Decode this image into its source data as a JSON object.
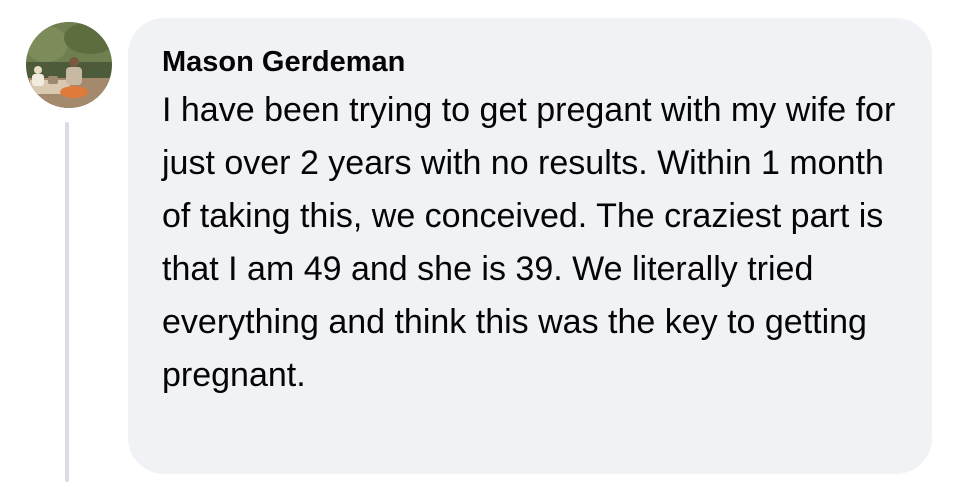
{
  "comment": {
    "author": "Mason Gerdeman",
    "text": "I have been trying to get pregant with my wife for just over 2 years with no results. Within 1 month of taking this, we conceived. The craziest part is that I am 49 and she is 39. We literally tried everything and think this was the key to getting pregnant."
  },
  "colors": {
    "bubble_background": "#f0f2f5",
    "text": "#050505",
    "thread_line": "#d9dde3"
  }
}
